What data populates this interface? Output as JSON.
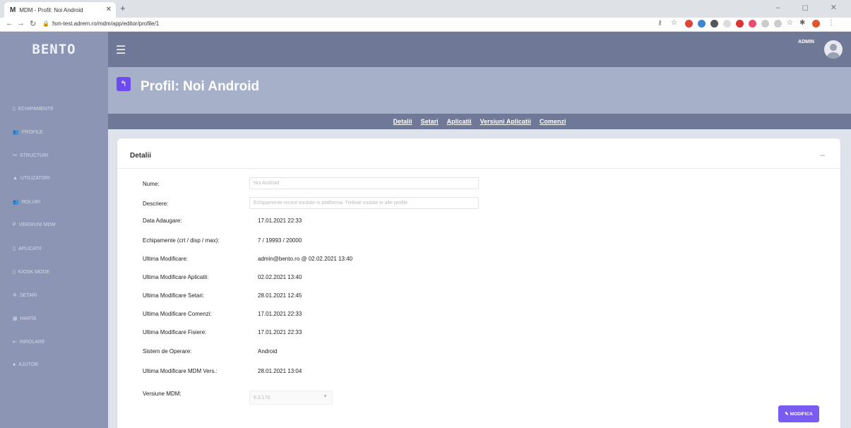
{
  "browser": {
    "tab_title": "MDM - Profil: Noi Android",
    "tab_icon": "M",
    "url": "fsm-test.adrem.ro/mdm/app/editor/profile/1"
  },
  "app": {
    "logo": "BENTO",
    "user": "ADMIN",
    "accent_color": "#6c4cf0",
    "sidebar_color": "#8c95b4",
    "topbar_color": "#6f7896"
  },
  "sidebar": {
    "items": [
      {
        "icon": "device-icon",
        "glyph": "▯",
        "label": "ECHIPAMENTE"
      },
      {
        "icon": "users-icon",
        "glyph": "👥",
        "label": "PROFILE"
      },
      {
        "icon": "structure-icon",
        "glyph": "⚯",
        "label": "STRUCTURI"
      },
      {
        "icon": "user-icon",
        "glyph": "▲",
        "label": "UTILIZATORI"
      },
      {
        "icon": "roles-icon",
        "glyph": "👥",
        "label": "ROLURI"
      },
      {
        "icon": "version-icon",
        "glyph": "P",
        "label": "VERSIUNI MDM"
      },
      {
        "icon": "apps-icon",
        "glyph": "▯",
        "label": "APLICATII"
      },
      {
        "icon": "kiosk-icon",
        "glyph": "▯",
        "label": "KIOSK MODE"
      },
      {
        "icon": "gear-icon",
        "glyph": "✲",
        "label": "SETARI"
      },
      {
        "icon": "map-icon",
        "glyph": "▦",
        "label": "HARTA"
      },
      {
        "icon": "enroll-icon",
        "glyph": "⇤",
        "label": "INROLARE"
      },
      {
        "icon": "help-icon",
        "glyph": "●",
        "label": "AJUTOR"
      }
    ]
  },
  "page": {
    "title": "Profil: Noi Android",
    "tabs": [
      "Detalii",
      "Setari",
      "Aplicatii",
      "Versiuni Aplicatii",
      "Comenzi"
    ]
  },
  "card": {
    "title": "Detalii",
    "collapse": "–",
    "fields": {
      "nume": {
        "label": "Nume:",
        "value": "Noi Android"
      },
      "descriere": {
        "label": "Descriere:",
        "value": "Echipamente recent inrolate in platforma. Trebuie mutate in alte profile."
      },
      "rows": [
        {
          "label": "Data Adaugare:",
          "value": "17.01.2021 22:33"
        },
        {
          "label": "Echipamente (crt / disp / max):",
          "value": "7 / 19993 / 20000"
        },
        {
          "label": "Ultima Modificare:",
          "value": "admin@bento.ro @ 02.02.2021 13:40"
        },
        {
          "label": "Ultima Modificare Aplicatii:",
          "value": "02.02.2021 13:40"
        },
        {
          "label": "Ultima Modificare Setari:",
          "value": "28.01.2021 12:45"
        },
        {
          "label": "Ultima Modificare Comenzi:",
          "value": "17.01.2021 22:33"
        },
        {
          "label": "Ultima Modificare Fisiere:",
          "value": "17.01.2021 22:33"
        },
        {
          "label": "Sistem de Operare:",
          "value": "Android"
        },
        {
          "label": "Ultima Modificare MDM Vers.:",
          "value": "28.01.2021 13:04"
        }
      ],
      "versiune": {
        "label": "Versiune MDM:",
        "value": "6.3.170"
      }
    },
    "button": "MODIFICA"
  }
}
